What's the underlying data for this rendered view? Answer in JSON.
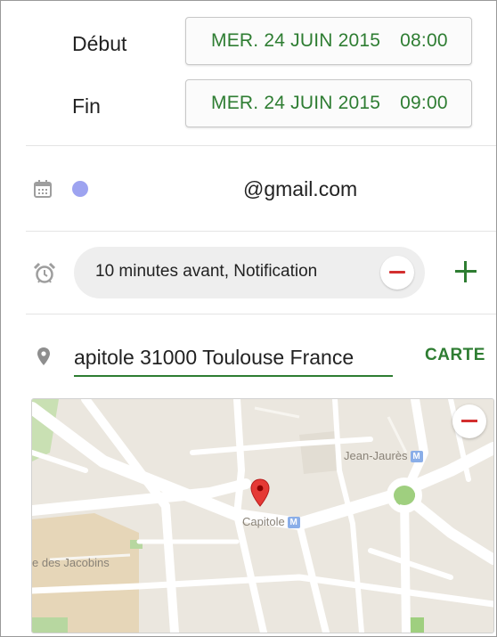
{
  "event": {
    "start": {
      "label": "Début",
      "date": "MER. 24 JUIN 2015",
      "time": "08:00"
    },
    "end": {
      "label": "Fin",
      "date": "MER. 24 JUIN 2015",
      "time": "09:00"
    }
  },
  "calendar": {
    "account_email": "@gmail.com",
    "color": "#9da3f0"
  },
  "reminder": {
    "text": "10 minutes avant, Notification"
  },
  "location": {
    "value": "apitole 31000 Toulouse France",
    "map_button": "CARTE"
  },
  "map": {
    "labels": {
      "jean_jaures": "Jean-Jaurès",
      "capitole": "Capitole",
      "jacobins": "e des Jacobins"
    },
    "metro_icon": "M"
  },
  "colors": {
    "accent": "#2e7d32",
    "remove": "#d32f2f",
    "marker": "#e53935"
  },
  "icons": {
    "calendar": "calendar-icon",
    "alarm": "alarm-icon",
    "location": "location-pin-icon",
    "add": "plus-icon",
    "remove": "minus-icon"
  }
}
